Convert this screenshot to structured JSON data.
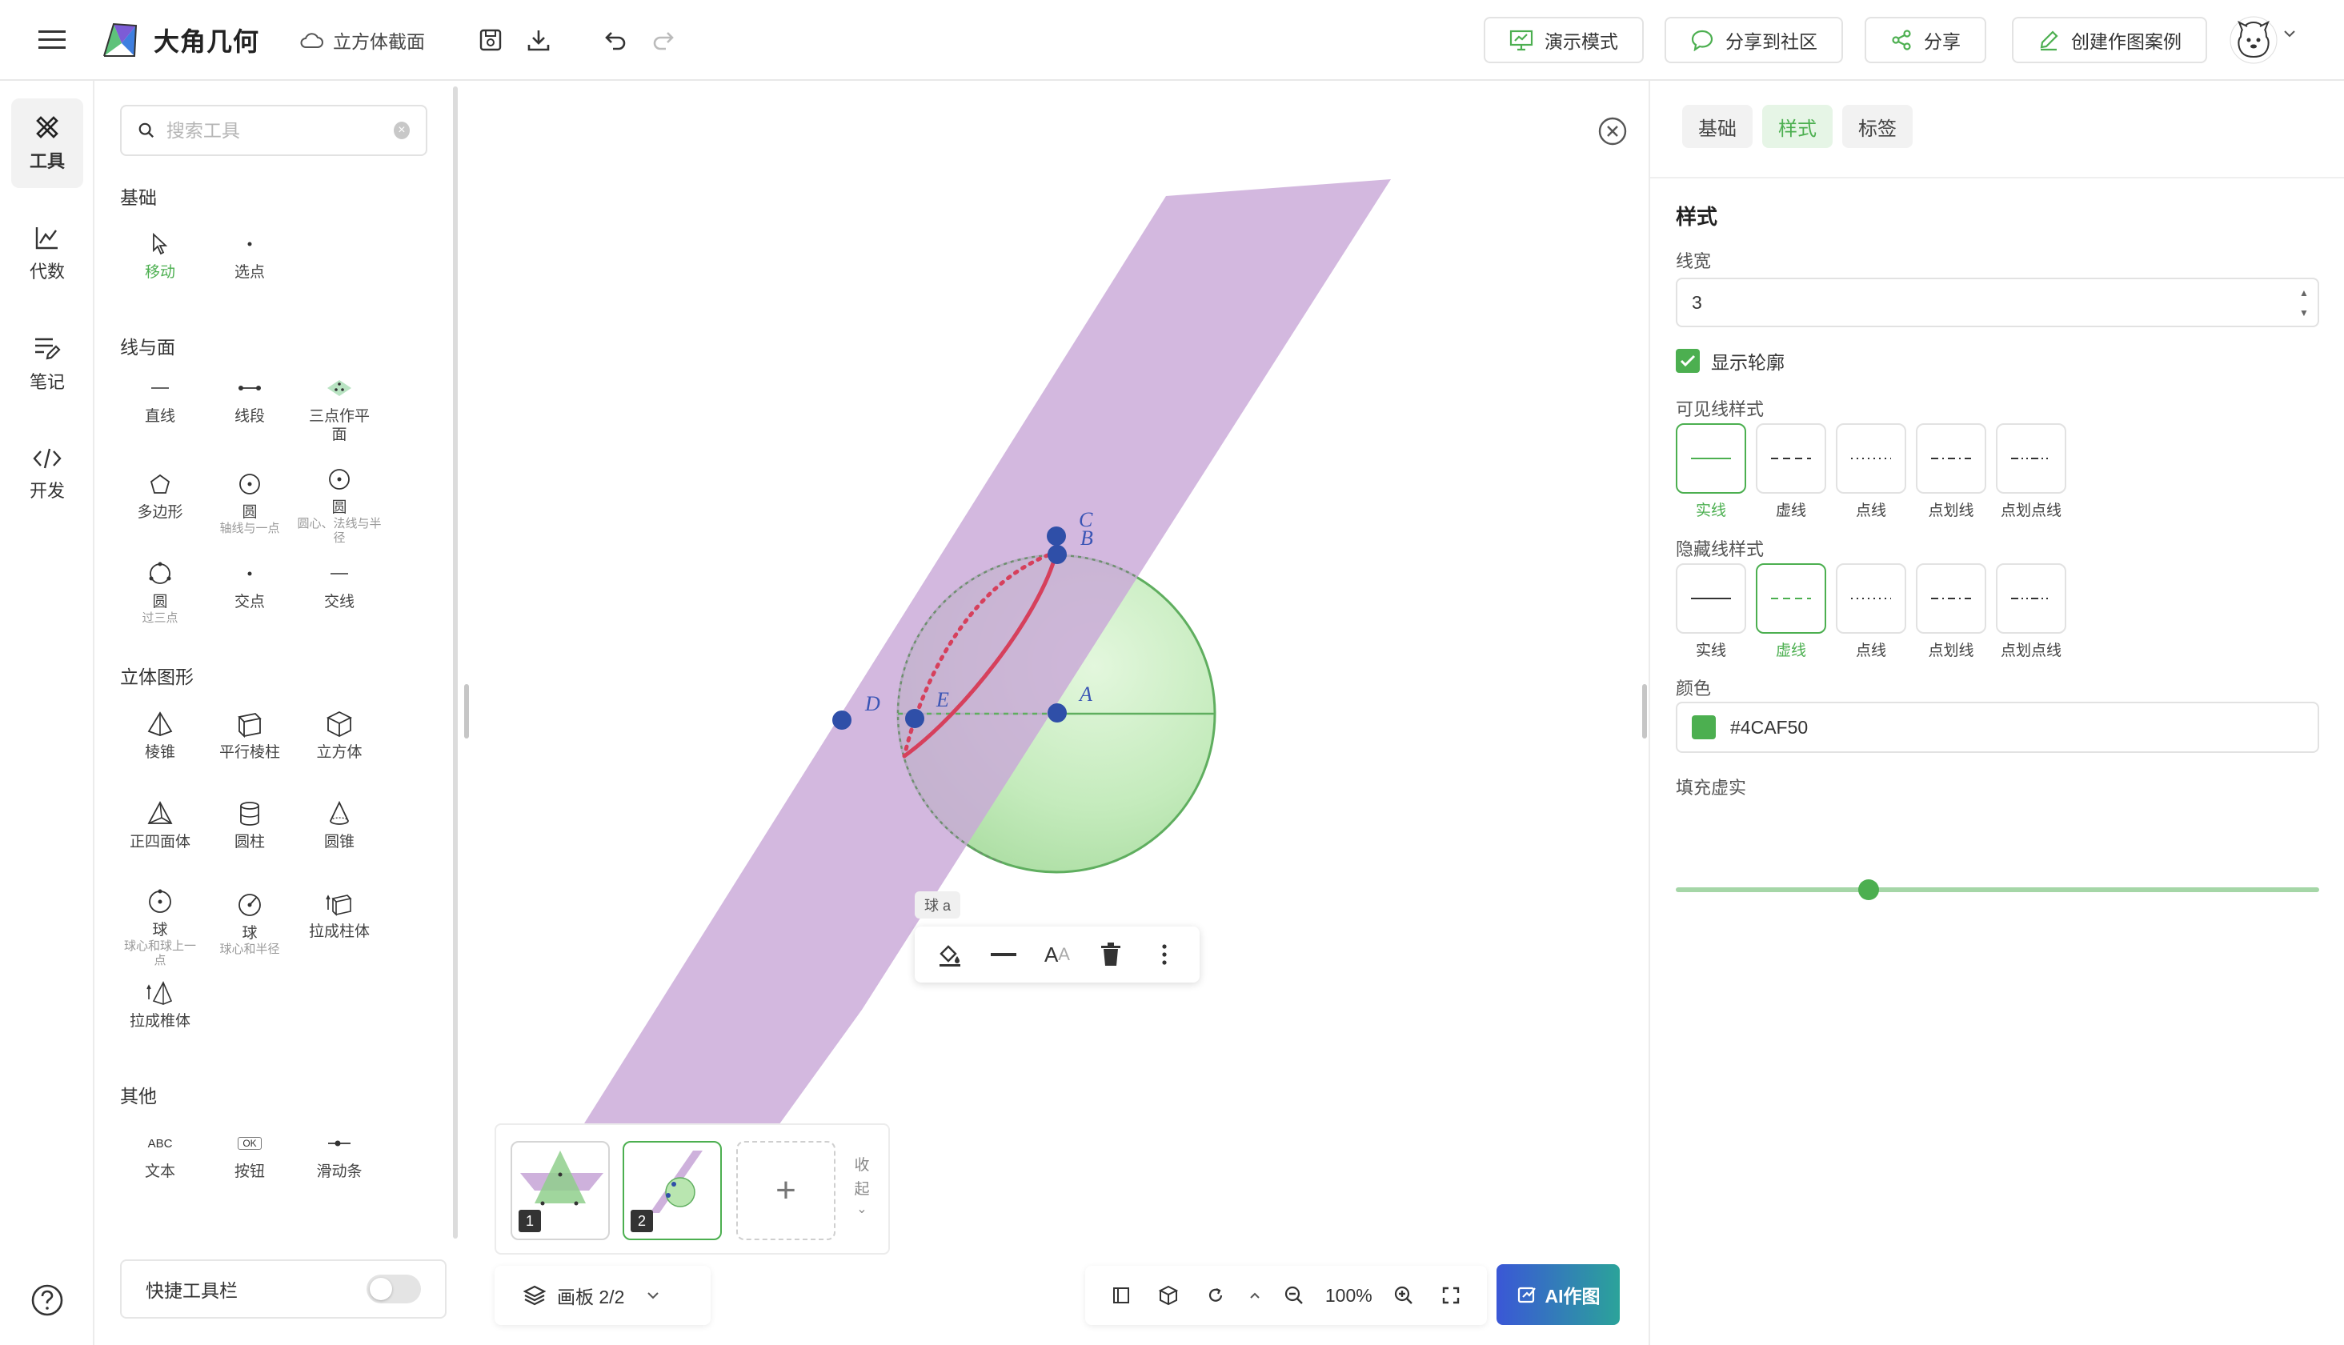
{
  "app": {
    "name": "大角几何",
    "doc_title": "立方体截面"
  },
  "header": {
    "buttons": [
      {
        "label": "演示模式",
        "icon": "presentation-icon"
      },
      {
        "label": "分享到社区",
        "icon": "chat-icon"
      },
      {
        "label": "分享",
        "icon": "share-icon"
      },
      {
        "label": "创建作图案例",
        "icon": "edit-icon"
      }
    ]
  },
  "rail": {
    "items": [
      {
        "label": "工具",
        "icon": "tools-icon",
        "active": true
      },
      {
        "label": "代数",
        "icon": "algebra-icon"
      },
      {
        "label": "笔记",
        "icon": "notes-icon"
      },
      {
        "label": "开发",
        "icon": "code-icon"
      }
    ]
  },
  "tools_panel": {
    "search_placeholder": "搜索工具",
    "sections": {
      "basic": "基础",
      "line_plane": "线与面",
      "solid": "立体图形",
      "other": "其他"
    },
    "basic": [
      {
        "label": "移动",
        "active": true
      },
      {
        "label": "选点"
      }
    ],
    "line_plane": [
      {
        "label": "直线"
      },
      {
        "label": "线段"
      },
      {
        "label": "三点作平面"
      },
      {
        "label": "多边形"
      },
      {
        "label": "圆",
        "sub": "轴线与一点"
      },
      {
        "label": "圆",
        "sub": "圆心、法线与半径"
      },
      {
        "label": "圆",
        "sub": "过三点"
      },
      {
        "label": "交点"
      },
      {
        "label": "交线"
      }
    ],
    "solid": [
      {
        "label": "棱锥"
      },
      {
        "label": "平行棱柱"
      },
      {
        "label": "立方体"
      },
      {
        "label": "正四面体"
      },
      {
        "label": "圆柱"
      },
      {
        "label": "圆锥"
      },
      {
        "label": "球",
        "sub": "球心和球上一点"
      },
      {
        "label": "球",
        "sub": "球心和半径"
      },
      {
        "label": "拉成柱体"
      },
      {
        "label": "拉成椎体"
      }
    ],
    "other": [
      {
        "label": "文本",
        "glyph": "ABC"
      },
      {
        "label": "按钮",
        "glyph": "OK"
      },
      {
        "label": "滑动条"
      }
    ],
    "quickbar_label": "快捷工具栏"
  },
  "canvas": {
    "point_labels": [
      "C",
      "B",
      "D",
      "E",
      "A"
    ],
    "object_tag": "球 a",
    "thumbnails": [
      "1",
      "2"
    ],
    "collapse_label": "收起",
    "board_label": "画板 2/2",
    "zoom": "100%",
    "ai_button": "AI作图"
  },
  "props": {
    "tabs": [
      {
        "label": "基础"
      },
      {
        "label": "样式",
        "active": true
      },
      {
        "label": "标签"
      }
    ],
    "heading": "样式",
    "line_width_label": "线宽",
    "line_width_value": "3",
    "show_outline_label": "显示轮廓",
    "visible_style_label": "可见线样式",
    "hidden_style_label": "隐藏线样式",
    "line_styles": [
      "实线",
      "虚线",
      "点线",
      "点划线",
      "点划点线"
    ],
    "visible_selected": 0,
    "hidden_selected": 1,
    "color_label": "颜色",
    "color_value": "#4CAF50",
    "fill_label": "填充虚实",
    "fill_level": 0.3
  },
  "colors": {
    "accent": "#4CAF50",
    "plane": "#c9a8d8",
    "sphere": "#b9e6b0",
    "curve": "#d6405c",
    "point": "#2f4fa8",
    "point_label": "#3a55b5"
  }
}
